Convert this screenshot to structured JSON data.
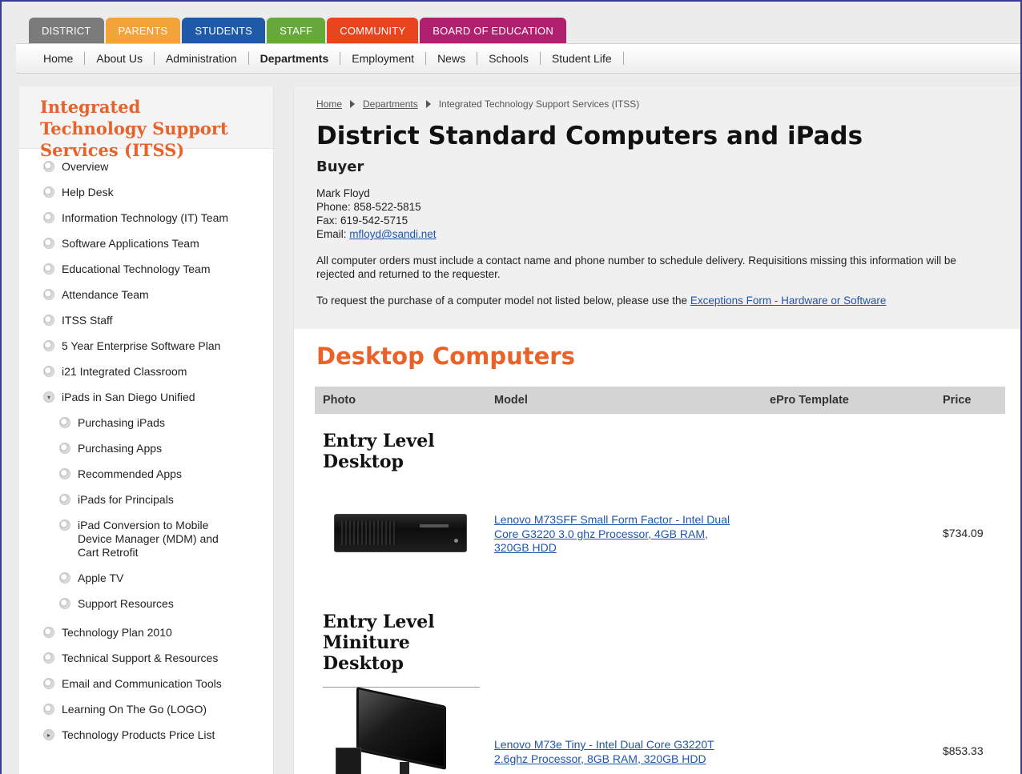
{
  "top_tabs": [
    {
      "label": "DISTRICT",
      "color": "#7b7b7b"
    },
    {
      "label": "PARENTS",
      "color": "#f2a33a"
    },
    {
      "label": "STUDENTS",
      "color": "#1e5aa8"
    },
    {
      "label": "STAFF",
      "color": "#67a83a"
    },
    {
      "label": "COMMUNITY",
      "color": "#e8441e"
    },
    {
      "label": "BOARD OF EDUCATION",
      "color": "#b1206e"
    }
  ],
  "nav": [
    "Home",
    "About Us",
    "Administration",
    "Departments",
    "Employment",
    "News",
    "Schools",
    "Student Life"
  ],
  "sidebar": {
    "title": "Integrated Technology Support Services (ITSS)",
    "items": [
      {
        "label": "Overview"
      },
      {
        "label": "Help Desk"
      },
      {
        "label": "Information Technology (IT) Team"
      },
      {
        "label": "Software Applications Team"
      },
      {
        "label": "Educational Technology Team"
      },
      {
        "label": "Attendance Team"
      },
      {
        "label": "ITSS Staff"
      },
      {
        "label": "5 Year Enterprise Software Plan"
      },
      {
        "label": "i21 Integrated Classroom"
      },
      {
        "label": "iPads in San Diego Unified"
      },
      {
        "label": "Purchasing iPads"
      },
      {
        "label": "Purchasing Apps"
      },
      {
        "label": "Recommended Apps"
      },
      {
        "label": "iPads for Principals"
      },
      {
        "label": "iPad Conversion to Mobile Device Manager (MDM) and Cart Retrofit"
      },
      {
        "label": "Apple TV"
      },
      {
        "label": "Support Resources"
      },
      {
        "label": "Technology Plan 2010"
      },
      {
        "label": "Technical Support & Resources"
      },
      {
        "label": "Email and Communication Tools"
      },
      {
        "label": "Learning On The Go (LOGO)"
      },
      {
        "label": "Technology Products Price List"
      }
    ]
  },
  "breadcrumb": {
    "home": "Home",
    "departments": "Departments",
    "current": "Integrated Technology Support Services (ITSS)"
  },
  "page_title": "District Standard Computers and iPads",
  "buyer": {
    "heading": "Buyer",
    "name": "Mark Floyd",
    "phone": "Phone: 858-522-5815",
    "fax": "Fax: 619-542-5715",
    "email_label": "Email:",
    "email": "mfloyd@sandi.net"
  },
  "notice": "All computer orders must include a contact name and phone number to schedule delivery. Requisitions missing this information will be rejected and returned to the requester.",
  "request_text": "To request the purchase of a computer model not listed below, please use the",
  "exceptions_link": "Exceptions Form - Hardware or Software",
  "section_title": "Desktop Computers",
  "table_headers": {
    "photo": "Photo",
    "model": "Model",
    "epro": "ePro Template",
    "price": "Price"
  },
  "products": [
    {
      "category": "Entry Level Desktop",
      "model": "Lenovo M73SFF Small Form Factor - Intel Dual Core G3220 3.0 ghz Processor, 4GB RAM, 320GB HDD",
      "price": "$734.09"
    },
    {
      "category": "Entry Level Miniture Desktop",
      "model": "Lenovo M73e Tiny - Intel Dual Core G3220T 2.6ghz Processor, 8GB RAM, 320GB HDD",
      "price": "$853.33"
    }
  ]
}
